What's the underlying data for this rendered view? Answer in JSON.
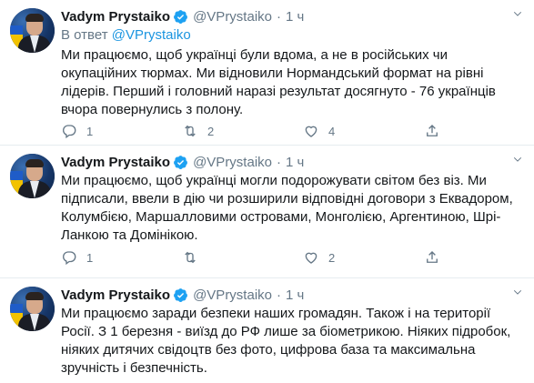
{
  "tweets": [
    {
      "name": "Vadym Prystaiko",
      "handle": "@VPrystaiko",
      "time": "1 ч",
      "reply_prefix": "В ответ",
      "reply_to": "@VPrystaiko",
      "text": "Ми працюємо, щоб українці були вдома, а не в російських чи окупаційних тюрмах. Ми відновили Нормандський формат на рівні лідерів. Перший і головний наразі результат досягнуто - 76 українців вчора повернулись з полону.",
      "replies": "1",
      "retweets": "2",
      "likes": "4"
    },
    {
      "name": "Vadym Prystaiko",
      "handle": "@VPrystaiko",
      "time": "1 ч",
      "text": "Ми працюємо, щоб українці могли подорожувати світом без віз. Ми підписали, ввели в дію чи розширили відповідні договори з Еквадором, Колумбією, Маршалловими островами, Монголією, Аргентиною, Шрі-Ланкою та Домінікою.",
      "replies": "1",
      "retweets": "",
      "likes": "2"
    },
    {
      "name": "Vadym Prystaiko",
      "handle": "@VPrystaiko",
      "time": "1 ч",
      "text": "Ми працюємо заради безпеки наших громадян. Також і на території Росії. З 1 березня - виїзд до РФ лише за біометрикою. Ніяких підробок, ніяких дитячих свідоцтв без фото, цифрова база та максимальна зручність і безпечність."
    }
  ],
  "separator": "·",
  "icons": {
    "verified": "verified-badge-icon",
    "caret": "chevron-down-icon",
    "reply": "reply-icon",
    "retweet": "retweet-icon",
    "like": "heart-icon",
    "share": "share-icon"
  },
  "colors": {
    "accent": "#1da1f2",
    "link": "#1b95e0",
    "muted": "#657786",
    "text": "#14171a"
  }
}
